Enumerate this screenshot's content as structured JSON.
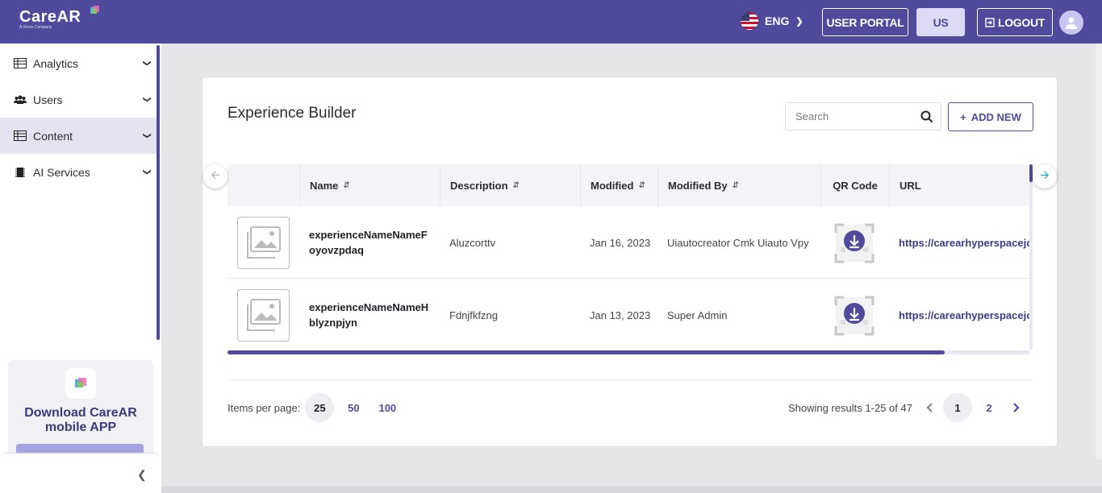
{
  "header": {
    "logo_text": "CareAR",
    "logo_sub": "A Xerox Company",
    "language": "ENG",
    "user_portal_label": "USER PORTAL",
    "us_label": "US",
    "logout_label": "LOGOUT"
  },
  "sidebar": {
    "items": [
      {
        "label": "Analytics",
        "icon": "table-icon"
      },
      {
        "label": "Users",
        "icon": "users-icon"
      },
      {
        "label": "Content",
        "icon": "table-icon"
      },
      {
        "label": "AI Services",
        "icon": "chip-icon"
      }
    ],
    "active_item": "Content",
    "promo_title": "Download CareAR mobile APP"
  },
  "main": {
    "title": "Experience Builder",
    "search_placeholder": "Search",
    "add_new_label": "ADD NEW",
    "columns": [
      "Name",
      "Description",
      "Modified",
      "Modified By",
      "QR Code",
      "URL"
    ],
    "rows": [
      {
        "name": "experienceNameNameFoyovzpdaq",
        "description": "Aluzcorttv",
        "modified": "Jan 16, 2023",
        "modified_by": "Uiautocreator Cmk Uiauto Vpy",
        "url": "https://carearhyperspacejoi"
      },
      {
        "name": "experienceNameNameHblyznpjyn",
        "description": "Fdnjfkfzng",
        "modified": "Jan 13, 2023",
        "modified_by": "Super Admin",
        "url": "https://carearhyperspacejoi"
      }
    ],
    "items_per_page_label": "Items per page:",
    "items_per_page_options": [
      "25",
      "50",
      "100"
    ],
    "items_per_page_selected": "25",
    "results_text": "Showing results 1-25 of 47",
    "pages": [
      "1",
      "2"
    ],
    "current_page": "1"
  },
  "colors": {
    "brand": "#4f4a9c",
    "accent_light": "#dcdaf4",
    "link": "#3c3a8a"
  }
}
